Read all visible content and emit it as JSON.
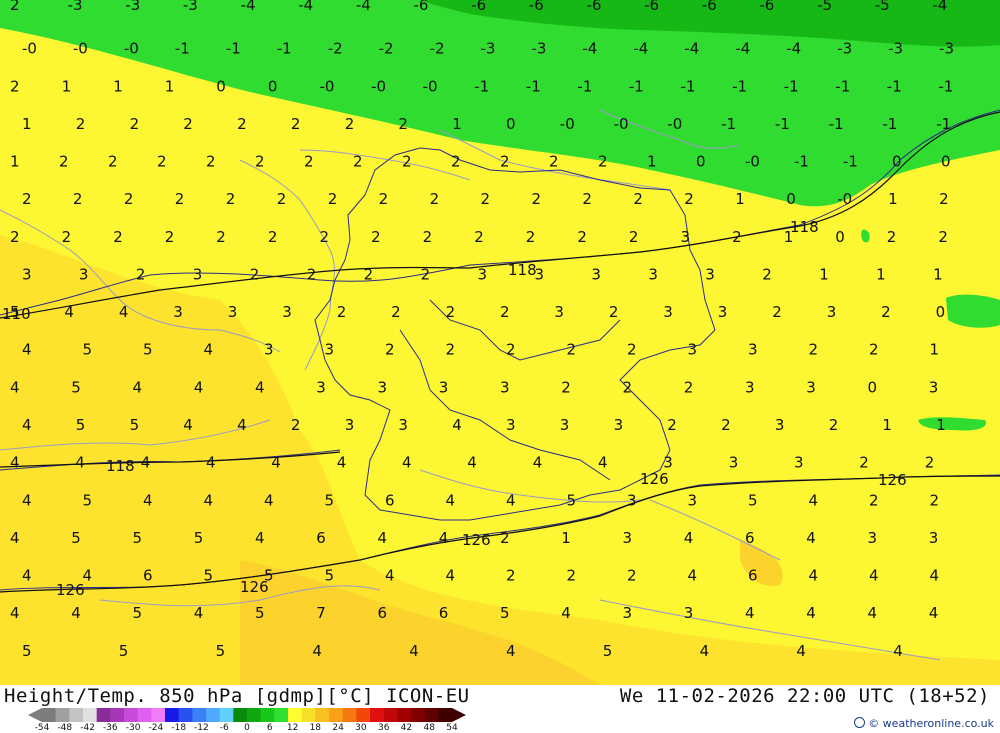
{
  "footer": {
    "title_left": "Height/Temp. 850 hPa [gdmp][°C] ICON-EU",
    "title_right": "We 11-02-2026 22:00 UTC (18+52)",
    "credit": "© weatheronline.co.uk"
  },
  "colorbar": {
    "ticks": [
      "-54",
      "-48",
      "-42",
      "-36",
      "-30",
      "-24",
      "-18",
      "-12",
      "-6",
      "0",
      "6",
      "12",
      "18",
      "24",
      "30",
      "36",
      "42",
      "48",
      "54"
    ],
    "colors": [
      "#7d7d7d",
      "#a0a0a0",
      "#c3c3c3",
      "#e0e0e0",
      "#8a2d9a",
      "#a638b8",
      "#c74ad8",
      "#e05ef0",
      "#f07cf8",
      "#1a1ae8",
      "#2a50f0",
      "#3a80f8",
      "#50a8ff",
      "#60d0ff",
      "#0a8a0a",
      "#10a810",
      "#18c818",
      "#30e030",
      "#ffff30",
      "#f8e028",
      "#f8c020",
      "#f8a018",
      "#f87810",
      "#f04808",
      "#e01010",
      "#c00808",
      "#a00000",
      "#800000",
      "#600000",
      "#400000"
    ]
  },
  "contour_labels": [
    "110",
    "118",
    "118",
    "118",
    "126",
    "126",
    "126",
    "126",
    "126"
  ],
  "temp_labels": [
    [
      "2",
      "-3",
      "-3",
      "-3",
      "-4",
      "-4",
      "-4",
      "-6",
      "-6",
      "-6",
      "-6",
      "-6",
      "-6",
      "-6",
      "-5",
      "-5",
      "-4"
    ],
    [
      "-0",
      "-0",
      "-0",
      "-1",
      "-1",
      "-1",
      "-2",
      "-2",
      "-2",
      "-3",
      "-3",
      "-4",
      "-4",
      "-4",
      "-4",
      "-4",
      "-3",
      "-3",
      "-3"
    ],
    [
      "2",
      "1",
      "1",
      "1",
      "0",
      "0",
      "-0",
      "-0",
      "-0",
      "-1",
      "-1",
      "-1",
      "-1",
      "-1",
      "-1",
      "-1",
      "-1",
      "-1",
      "-1"
    ],
    [
      "1",
      "2",
      "2",
      "2",
      "2",
      "2",
      "2",
      "2",
      "1",
      "0",
      "-0",
      "-0",
      "-0",
      "-1",
      "-1",
      "-1",
      "-1",
      "-1"
    ],
    [
      "1",
      "2",
      "2",
      "2",
      "2",
      "2",
      "2",
      "2",
      "2",
      "2",
      "2",
      "2",
      "2",
      "1",
      "0",
      "-0",
      "-1",
      "-1",
      "0",
      "0"
    ],
    [
      "2",
      "2",
      "2",
      "2",
      "2",
      "2",
      "2",
      "2",
      "2",
      "2",
      "2",
      "2",
      "2",
      "2",
      "1",
      "0",
      "-0",
      "1",
      "2"
    ],
    [
      "2",
      "2",
      "2",
      "2",
      "2",
      "2",
      "2",
      "2",
      "2",
      "2",
      "2",
      "2",
      "2",
      "3",
      "2",
      "1",
      "0",
      "2",
      "2"
    ],
    [
      "3",
      "3",
      "2",
      "3",
      "2",
      "2",
      "2",
      "2",
      "3",
      "3",
      "3",
      "3",
      "3",
      "2",
      "1",
      "1",
      "1"
    ],
    [
      "5",
      "4",
      "4",
      "3",
      "3",
      "3",
      "2",
      "2",
      "2",
      "2",
      "3",
      "2",
      "3",
      "3",
      "2",
      "3",
      "2",
      "0"
    ],
    [
      "4",
      "5",
      "5",
      "4",
      "3",
      "3",
      "2",
      "2",
      "2",
      "2",
      "2",
      "3",
      "3",
      "2",
      "2",
      "1"
    ],
    [
      "4",
      "5",
      "4",
      "4",
      "4",
      "3",
      "3",
      "3",
      "3",
      "2",
      "2",
      "2",
      "3",
      "3",
      "0",
      "3"
    ],
    [
      "4",
      "5",
      "5",
      "4",
      "4",
      "2",
      "3",
      "3",
      "4",
      "3",
      "3",
      "3",
      "2",
      "2",
      "3",
      "2",
      "1",
      "1"
    ],
    [
      "4",
      "4",
      "4",
      "4",
      "4",
      "4",
      "4",
      "4",
      "4",
      "4",
      "3",
      "3",
      "3",
      "2",
      "2"
    ],
    [
      "4",
      "5",
      "4",
      "4",
      "4",
      "5",
      "6",
      "4",
      "4",
      "5",
      "3",
      "3",
      "5",
      "4",
      "2",
      "2"
    ],
    [
      "4",
      "5",
      "5",
      "5",
      "4",
      "6",
      "4",
      "4",
      "2",
      "1",
      "3",
      "4",
      "6",
      "4",
      "3",
      "3"
    ],
    [
      "4",
      "4",
      "6",
      "5",
      "5",
      "5",
      "4",
      "4",
      "2",
      "2",
      "2",
      "4",
      "6",
      "4",
      "4",
      "4"
    ],
    [
      "4",
      "4",
      "5",
      "4",
      "5",
      "7",
      "6",
      "6",
      "5",
      "4",
      "3",
      "3",
      "4",
      "4",
      "4",
      "4"
    ],
    [
      "5",
      "5",
      "5",
      "4",
      "4",
      "4",
      "5",
      "4",
      "4",
      "4"
    ]
  ]
}
